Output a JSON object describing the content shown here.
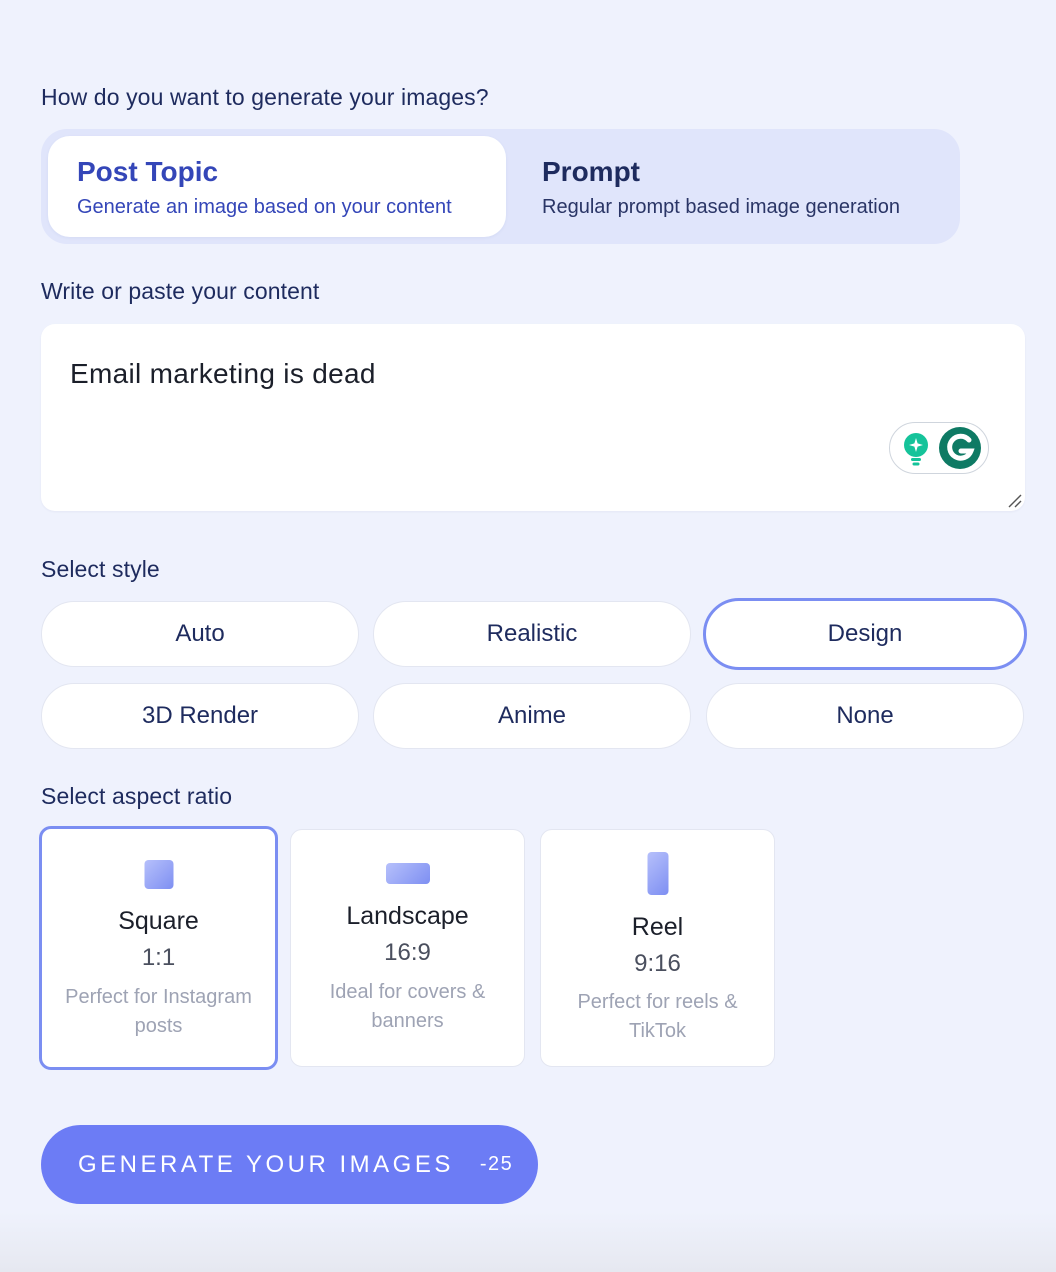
{
  "generation_question": "How do you want to generate your images?",
  "modes": [
    {
      "title": "Post Topic",
      "description": "Generate an image based on your content",
      "active": true
    },
    {
      "title": "Prompt",
      "description": "Regular prompt based image generation",
      "active": false
    }
  ],
  "content": {
    "label": "Write or paste your content",
    "value": "Email marketing is dead"
  },
  "style": {
    "label": "Select style",
    "options": [
      "Auto",
      "Realistic",
      "Design",
      "3D Render",
      "Anime",
      "None"
    ],
    "selected": "Design"
  },
  "aspect": {
    "label": "Select aspect ratio",
    "options": [
      {
        "name": "Square",
        "ratio": "1:1",
        "description": "Perfect for Instagram posts"
      },
      {
        "name": "Landscape",
        "ratio": "16:9",
        "description": "Ideal for covers & banners"
      },
      {
        "name": "Reel",
        "ratio": "9:16",
        "description": "Perfect for reels & TikTok"
      }
    ],
    "selected": "Square"
  },
  "generate": {
    "label": "GENERATE YOUR IMAGES",
    "cost": "-25"
  },
  "colors": {
    "accent": "#6c7cf5",
    "selected_border": "#7b8ef2",
    "background": "#eff2fd"
  }
}
